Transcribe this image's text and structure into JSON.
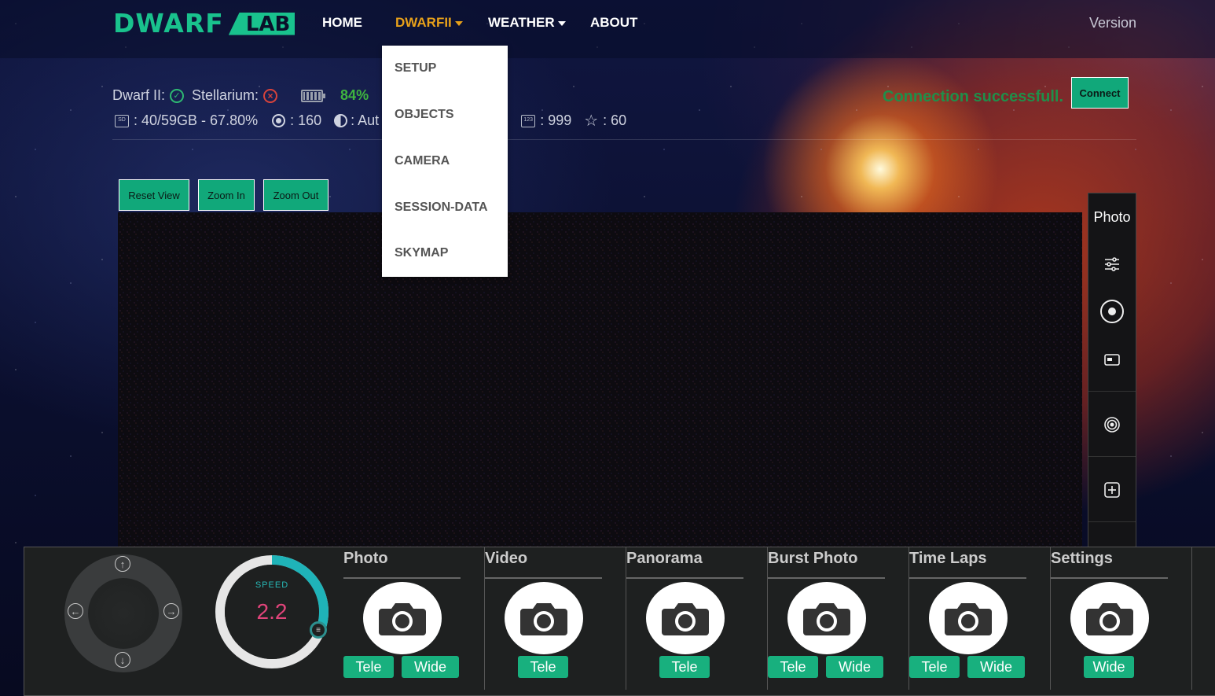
{
  "nav": {
    "brand_main": "DWARF",
    "brand_lab": "LAB",
    "items": [
      "HOME",
      "DWARFII",
      "WEATHER",
      "ABOUT"
    ],
    "version": "Version",
    "active_color": "#e8a11a"
  },
  "dropdown": {
    "items": [
      "SETUP",
      "OBJECTS",
      "CAMERA",
      "SESSION-DATA",
      "SKYMAP"
    ]
  },
  "status": {
    "dwarf_label": "Dwarf II:",
    "stellarium_label": "Stellarium:",
    "battery": "84%",
    "storage": ": 40/59GB - 67.80%",
    "gain": ": 160",
    "exposure": ": Aut",
    "count": ": 999",
    "stars": ": 60",
    "connection_message": "Connection successfull.",
    "connect_label": "Connect"
  },
  "view_controls": {
    "reset": "Reset View",
    "zoom_in": "Zoom In",
    "zoom_out": "Zoom Out"
  },
  "side_panel": {
    "title": "Photo",
    "icons": [
      "sliders-icon",
      "record-icon",
      "window-icon",
      "target-icon",
      "plus-box-icon"
    ]
  },
  "speed": {
    "label": "SPEED",
    "value": "2.2",
    "level": 0.3
  },
  "modes": [
    {
      "title": "Photo",
      "buttons": [
        "Tele",
        "Wide"
      ]
    },
    {
      "title": "Video",
      "buttons": [
        "Tele"
      ]
    },
    {
      "title": "Panorama",
      "buttons": [
        "Tele"
      ]
    },
    {
      "title": "Burst Photo",
      "buttons": [
        "Tele",
        "Wide"
      ]
    },
    {
      "title": "Time Laps",
      "buttons": [
        "Tele",
        "Wide"
      ]
    },
    {
      "title": "Settings",
      "buttons": [
        "Wide"
      ]
    }
  ],
  "colors": {
    "accent": "#19c28d",
    "button": "#11a87a",
    "success_text": "#1f8f4a",
    "battery_text": "#3fb53f",
    "error": "#d9433b",
    "speed_ring": "#1fb3b8",
    "speed_value": "#e0447a"
  }
}
